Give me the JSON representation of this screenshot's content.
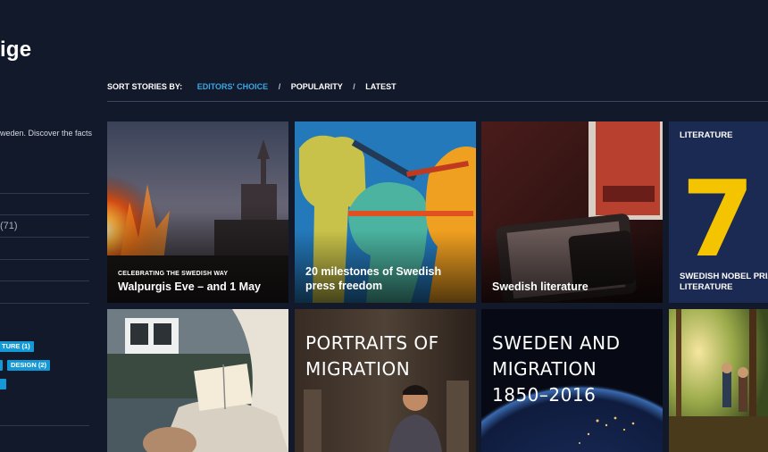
{
  "sidebar": {
    "title_fragment": "ige",
    "intro_fragment": "weden. Discover the facts",
    "count_fragment": "(71)",
    "tags": [
      {
        "label": "ture",
        "count": "(1)"
      },
      {
        "label": "Design",
        "count": "(2)"
      }
    ]
  },
  "sort": {
    "label": "Sort stories by:",
    "options": [
      {
        "label": "Editors' choice",
        "active": true
      },
      {
        "label": "Popularity",
        "active": false
      },
      {
        "label": "Latest",
        "active": false
      }
    ],
    "separator": "/"
  },
  "stories": [
    {
      "kicker": "Celebrating the Swedish way",
      "title": "Walpurgis Eve – and 1 May"
    },
    {
      "kicker": "",
      "title": "20 milestones of Swedish press freedom"
    },
    {
      "kicker": "",
      "title": "Swedish literature"
    },
    {
      "label": "Literature",
      "number": "7",
      "bottom": "Swedish Nobel Prize in Literature"
    },
    {
      "title": ""
    },
    {
      "title": "Portraits of\nmigration"
    },
    {
      "title": "Sweden and\nmigration\n1850–2016"
    },
    {
      "title": ""
    }
  ],
  "colors": {
    "background": "#12192a",
    "accent_blue": "#1599d6",
    "literature_yellow": "#f5c400",
    "literature_card": "#1b2a52"
  }
}
